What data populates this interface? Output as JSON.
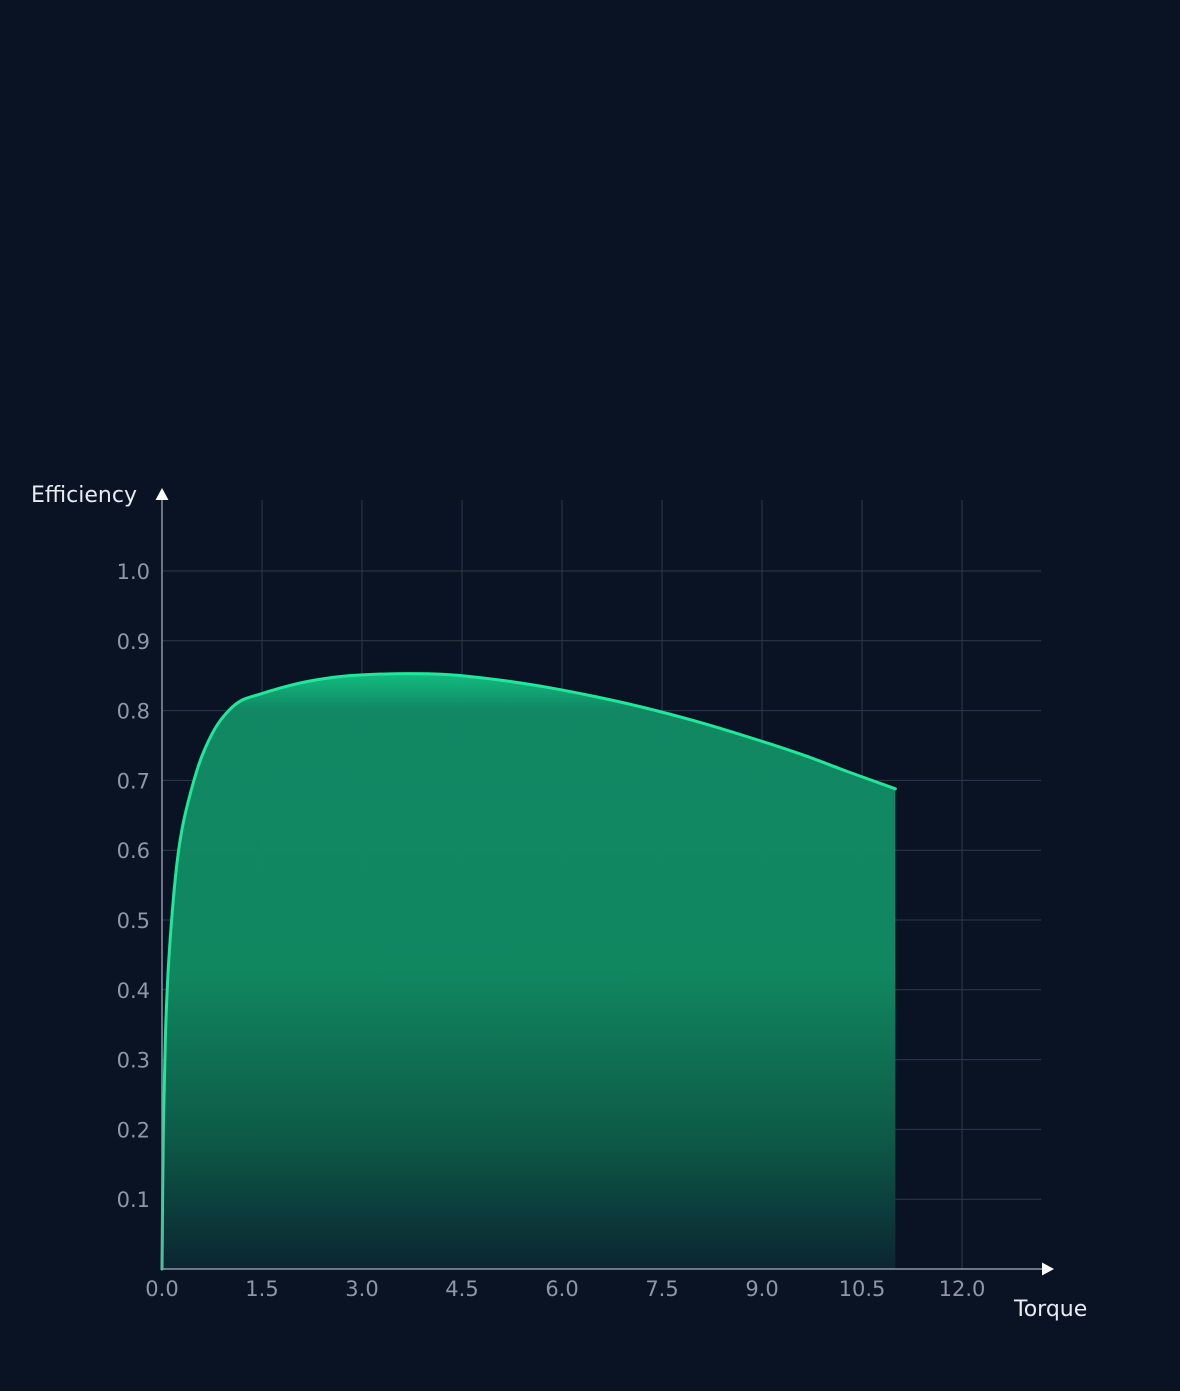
{
  "chart_data": {
    "type": "area",
    "title": "",
    "xlabel": "Torque",
    "ylabel": "Efficiency",
    "xlim": [
      0,
      13.2
    ],
    "ylim": [
      0,
      1.1
    ],
    "x_ticks": [
      "0.0",
      "1.5",
      "3.0",
      "4.5",
      "6.0",
      "7.5",
      "9.0",
      "10.5",
      "12.0"
    ],
    "y_ticks": [
      "0.1",
      "0.2",
      "0.3",
      "0.4",
      "0.5",
      "0.6",
      "0.7",
      "0.8",
      "0.9",
      "1.0"
    ],
    "grid": true,
    "series": [
      {
        "x": [
          0,
          0.02,
          0.05,
          0.1,
          0.2,
          0.3,
          0.45,
          0.6,
          0.8,
          1.0,
          1.2,
          1.45,
          1.8,
          2.2,
          2.7,
          3.2,
          3.7,
          4.2,
          4.7,
          5.2,
          5.8,
          6.5,
          7.2,
          8.0,
          8.8,
          9.6,
          10.3,
          11.0
        ],
        "y": [
          0,
          0.2,
          0.33,
          0.44,
          0.56,
          0.63,
          0.69,
          0.735,
          0.775,
          0.8,
          0.815,
          0.823,
          0.833,
          0.842,
          0.849,
          0.852,
          0.853,
          0.852,
          0.848,
          0.842,
          0.833,
          0.82,
          0.805,
          0.785,
          0.762,
          0.737,
          0.712,
          0.688
        ]
      }
    ],
    "colors": {
      "background": "#0a1323",
      "line": "#1fe89a",
      "fill_top": "#12b47a",
      "fill_bottom": "#0c2a33",
      "grid": "#2e3a4b",
      "axis": "#8e96a4",
      "tick_label": "#8f97a6",
      "axis_title": "#e8ebf0"
    }
  }
}
